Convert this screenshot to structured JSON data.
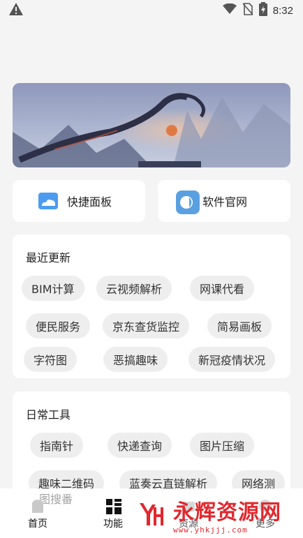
{
  "status_bar": {
    "time": "8:32"
  },
  "quick_cards": [
    {
      "label": "快捷面板",
      "icon": "cloud-icon",
      "color": "#4b9cf0"
    },
    {
      "label": "软件官网",
      "icon": "toggle-icon",
      "color": "#5aa0e0"
    }
  ],
  "recent": {
    "title": "最近更新",
    "items": [
      "BIM计算",
      "云视频解析",
      "网课代看",
      "便民服务",
      "京东查货监控",
      "简易画板",
      "字符图",
      "恶搞趣味",
      "新冠疫情状况"
    ]
  },
  "daily": {
    "title": "日常工具",
    "items": [
      "指南针",
      "快递查询",
      "图片压缩",
      "趣味二维码",
      "蓝奏云直链解析",
      "网络测",
      "图搜番"
    ]
  },
  "bottom_nav": [
    {
      "label": "首页",
      "icon": "home-icon"
    },
    {
      "label": "功能",
      "icon": "grid-icon"
    },
    {
      "label": "资源",
      "icon": "folder-icon"
    },
    {
      "label": "更多",
      "icon": "more-icon"
    }
  ],
  "watermark": {
    "main": "永辉资源网",
    "sub": "www.yhkjjj.com",
    "logo": "YH"
  },
  "colors": {
    "accent_red": "#e0282e",
    "background": "#f4f4f4"
  }
}
